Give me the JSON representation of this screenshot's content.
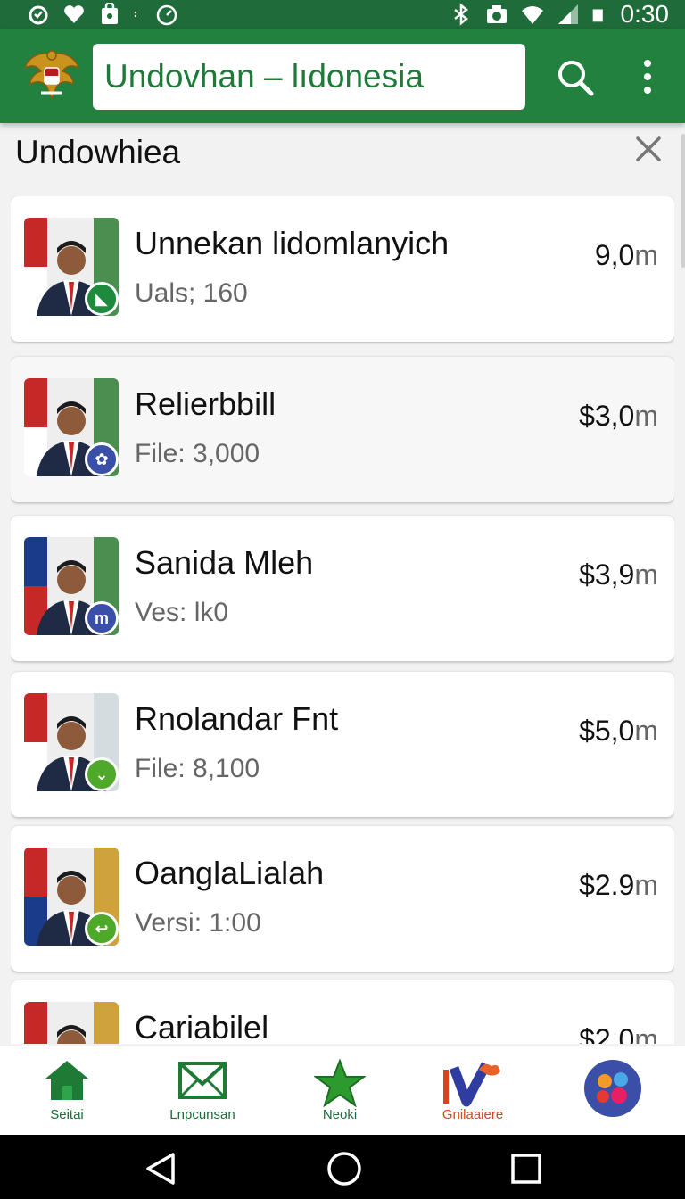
{
  "status_bar": {
    "time": "0:30",
    "left_icons": [
      "alarm-icon",
      "heart-icon",
      "shopping-bag-icon",
      "dots-icon",
      "timer-icon"
    ],
    "right_icons": [
      "bluetooth-icon",
      "camera-icon",
      "wifi-icon",
      "signal-icon",
      "battery-icon"
    ]
  },
  "app_bar": {
    "search_text": "Undovhan  –  lıdonesia",
    "logo": "garuda-emblem-icon",
    "colors": {
      "primary": "#23813f",
      "status": "#1f6b3a",
      "search_text": "#1f7a3a"
    }
  },
  "list_header": {
    "title": "Undowhiea"
  },
  "items": [
    {
      "title": "Unnekan lidomlanyich",
      "subtitle": "Uals; 160",
      "price_main": "9,0",
      "price_unit": "m",
      "badge_color": "#1e8a3e",
      "badge_glyph": "◣"
    },
    {
      "title": "Relierbbill",
      "subtitle": "File: 3,000",
      "price_main": "$3,0",
      "price_unit": "m",
      "badge_color": "#3a4fa8",
      "badge_glyph": "✿"
    },
    {
      "title": "Sanida Mleh",
      "subtitle": "Ves: lk0",
      "price_main": "$3,9",
      "price_unit": "m",
      "badge_color": "#3a4fa8",
      "badge_glyph": "m"
    },
    {
      "title": "Rnolandar Fnt",
      "subtitle": "File: 8,100",
      "price_main": "$5,0",
      "price_unit": "m",
      "badge_color": "#4ea82a",
      "badge_glyph": "⌄"
    },
    {
      "title": "OanglaLialah",
      "subtitle": "Versi: 1:00",
      "price_main": "$2.9",
      "price_unit": "m",
      "badge_color": "#4ea82a",
      "badge_glyph": "↩"
    },
    {
      "title": "Cariabilel",
      "subtitle": "",
      "price_main": "$2,0",
      "price_unit": "m",
      "badge_color": "#4ea82a",
      "badge_glyph": ""
    }
  ],
  "bottom_nav": [
    {
      "label": "Seitai",
      "icon": "home-icon"
    },
    {
      "label": "Lnpcunsan",
      "icon": "mail-icon"
    },
    {
      "label": "Neoki",
      "icon": "star-icon"
    },
    {
      "label": "Gnilaaiere",
      "icon": "checkmark-logo-icon"
    },
    {
      "label": "",
      "icon": "apps-icon"
    }
  ],
  "system_nav": [
    "back-icon",
    "home-circle-icon",
    "recents-icon"
  ]
}
